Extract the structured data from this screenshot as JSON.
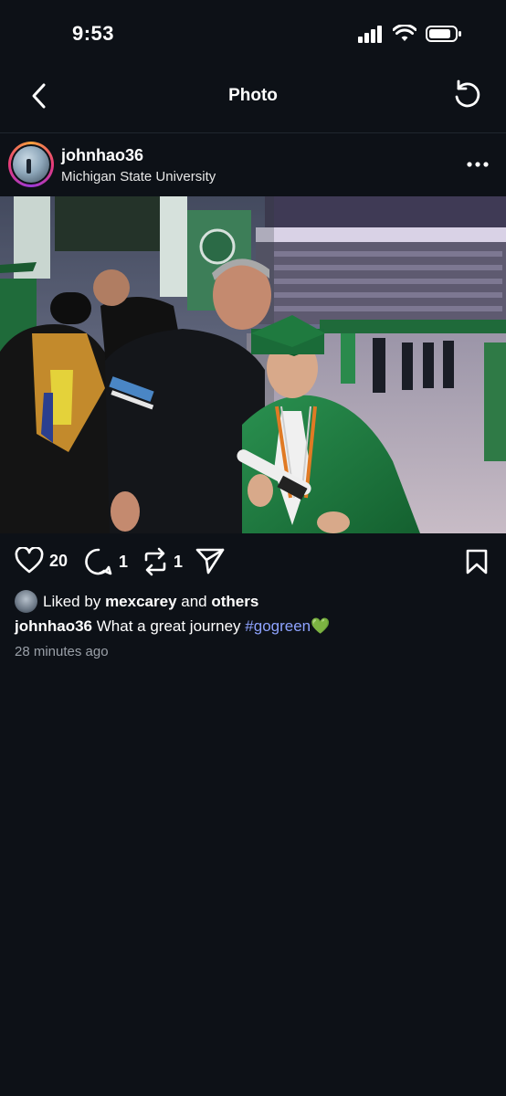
{
  "status_bar": {
    "time": "9:53"
  },
  "nav": {
    "title": "Photo"
  },
  "post": {
    "username": "johnhao36",
    "location": "Michigan State University",
    "likes_count": "20",
    "comments_count": "1",
    "reposts_count": "1",
    "liked_by_prefix": "Liked by",
    "liked_by_user": "mexcarey",
    "liked_by_and": "and",
    "liked_by_others": "others",
    "caption_user": "johnhao36",
    "caption_text": "What a great journey",
    "caption_hashtag": "#gogreen",
    "caption_emoji": "💚",
    "timestamp": "28 minutes ago"
  },
  "colors": {
    "background": "#0d1117",
    "hashtag": "#8ea3ff",
    "gown_green": "#1f7a3f"
  }
}
